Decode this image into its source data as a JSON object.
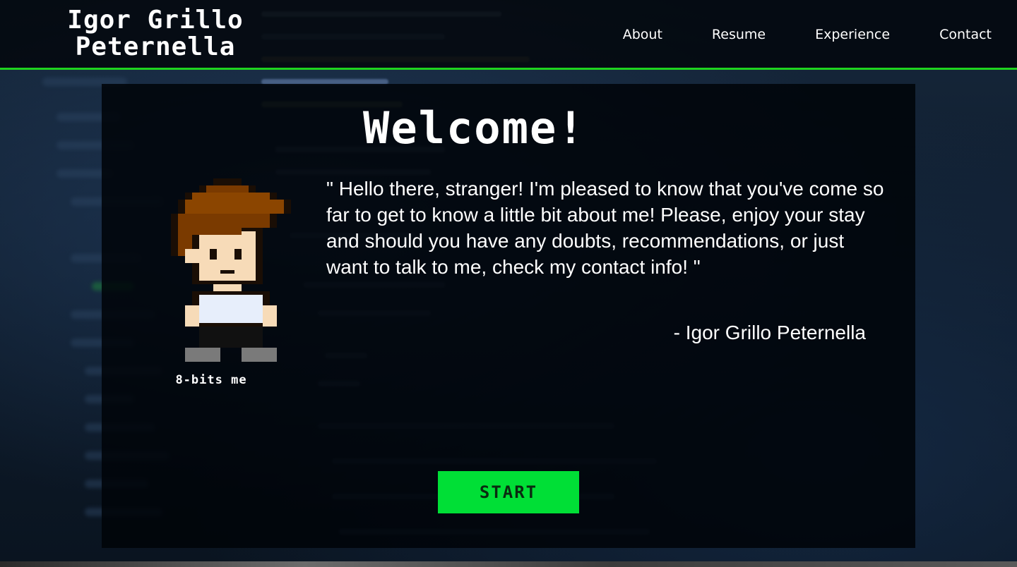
{
  "header": {
    "brand_line1": "Igor Grillo",
    "brand_line2": "Peternella",
    "nav": [
      {
        "label": "About"
      },
      {
        "label": "Resume"
      },
      {
        "label": "Experience"
      },
      {
        "label": "Contact"
      }
    ]
  },
  "main": {
    "heading": "Welcome!",
    "avatar_caption": "8-bits me",
    "quote": "\" Hello there, stranger! I'm pleased to know that you've come so far to get to know a little bit about me! Please, enjoy your stay and should you have any doubts, recommendations, or just want to talk to me, check my contact info! \"",
    "author": "- Igor Grillo Peternella",
    "start_label": "START"
  },
  "colors": {
    "accent": "#1fd41f",
    "button": "#00df36",
    "panel": "#000308"
  }
}
